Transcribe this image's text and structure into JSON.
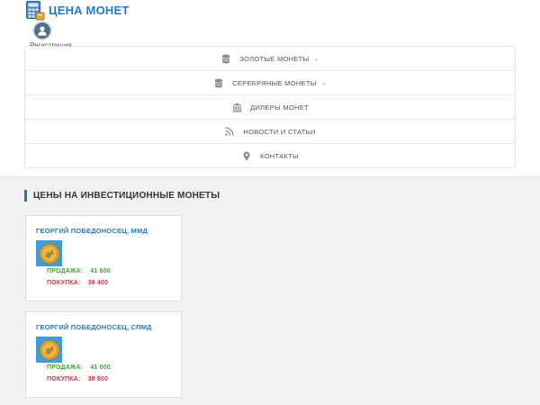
{
  "brand": {
    "name": "ЦЕНА МОНЕТ"
  },
  "user": {
    "register_label": "Регистрация"
  },
  "nav": [
    {
      "label": "ЗОЛОТЫЕ МОНЕТЫ",
      "icon": "coins-stack-icon",
      "dropdown": true
    },
    {
      "label": "СЕРЕБРЯНЫЕ МОНЕТЫ",
      "icon": "coins-stack-icon",
      "dropdown": true
    },
    {
      "label": "ДИЛЕРЫ МОНЕТ",
      "icon": "bank-icon",
      "dropdown": false
    },
    {
      "label": "НОВОСТИ И СТАТЬИ",
      "icon": "rss-icon",
      "dropdown": false
    },
    {
      "label": "КОНТАКТЫ",
      "icon": "map-pin-icon",
      "dropdown": false
    }
  ],
  "section": {
    "title": "ЦЕНЫ НА ИНВЕСТИЦИОННЫЕ МОНЕТЫ"
  },
  "coins": [
    {
      "name": "ГЕОРГИЙ ПОБЕДОНОСЕЦ, ММД",
      "sell_label": "ПРОДАЖА:",
      "sell_value": "41 600",
      "buy_label": "ПОКУПКА:",
      "buy_value": "39 400"
    },
    {
      "name": "ГЕОРГИЙ ПОБЕДОНОСЕЦ, СПМД",
      "sell_label": "ПРОДАЖА:",
      "sell_value": "41 000",
      "buy_label": "ПОКУПКА:",
      "buy_value": "38 800"
    }
  ],
  "colors": {
    "brand_blue": "#1f7bc8",
    "sell_green": "#3aa62a",
    "buy_red": "#c2384a",
    "accent_bar": "#2f6fc6"
  }
}
